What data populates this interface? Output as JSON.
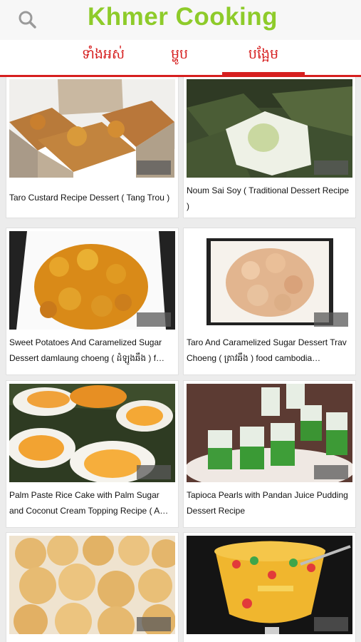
{
  "app": {
    "title": "Khmer Cooking",
    "accent": "#d61f1f",
    "title_color": "#8ecb2a"
  },
  "tabs": [
    {
      "label": "ទាំងអស់"
    },
    {
      "label": "ម្ហូប"
    },
    {
      "label": "បង្អែម",
      "active": true
    }
  ],
  "recipes": [
    {
      "title": "Taro Custard Recipe Dessert ( Tang Trou )"
    },
    {
      "title": "Noum Sai Soy ( Traditional Dessert Recipe )"
    },
    {
      "title": "Sweet Potatoes And Caramelized Sugar Dessert damlaung choeng ( ដំឡូងឆឹង ) f…"
    },
    {
      "title": "Taro And Caramelized Sugar Dessert Trav Choeng ( ត្រាវឆឹង ) food cambodia…"
    },
    {
      "title": "Palm Paste Rice Cake with Palm Sugar and Coconut Cream Topping Recipe ( A…"
    },
    {
      "title": "Tapioca Pearls with Pandan Juice Pudding Dessert Recipe"
    },
    {
      "title": ""
    },
    {
      "title": ""
    }
  ],
  "icons": {
    "search": "search-icon",
    "thumb_badge": "video-badge-icon"
  }
}
